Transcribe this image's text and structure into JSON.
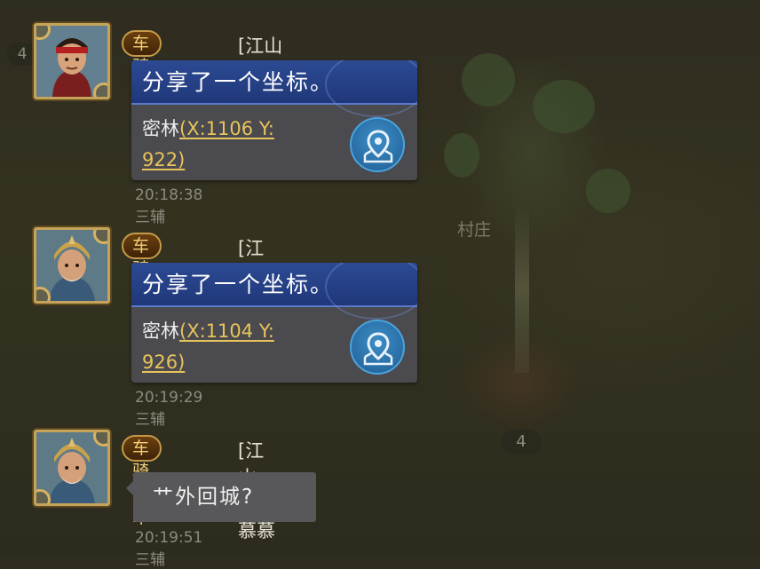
{
  "map": {
    "village_label": "村庄",
    "level_badge": "4",
    "top_level_badge": "4"
  },
  "messages": [
    {
      "rank": "车骑将军",
      "sender": "[江山梦]Js、余生",
      "share_title": "分享了一个坐标。",
      "place": "密林",
      "coord_line1": "(X:1106 Y:",
      "coord_line2": "922)",
      "time": "20:18:38 三辅"
    },
    {
      "rank": "车骑将军",
      "sender": "[江山梦]JS慕慕",
      "share_title": "分享了一个坐标。",
      "place": "密林",
      "coord_line1": "(X:1104 Y:",
      "coord_line2": "926)",
      "time": "20:19:29 三辅"
    },
    {
      "rank": "车骑将军",
      "sender": "[江山梦]JS慕慕",
      "text": "艹外回城?",
      "time": "20:19:51 三辅"
    }
  ],
  "icons": {
    "locate": "map-pin-icon",
    "avatar1": "general-red-headband-avatar",
    "avatar2": "general-gold-helmet-avatar"
  },
  "colors": {
    "rank_text": "#f5cf78",
    "coord_link": "#e8c45a",
    "share_header": "#2c4a93",
    "locate_button": "#2f7fb8"
  }
}
